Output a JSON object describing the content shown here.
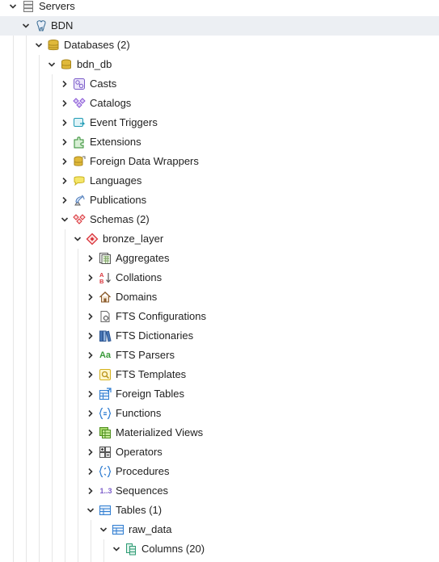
{
  "tree": {
    "servers": "Servers",
    "bdn": "BDN",
    "databases": "Databases (2)",
    "bdn_db": "bdn_db",
    "casts": "Casts",
    "catalogs": "Catalogs",
    "event_triggers": "Event Triggers",
    "extensions": "Extensions",
    "foreign_data_wrappers": "Foreign Data Wrappers",
    "languages": "Languages",
    "publications": "Publications",
    "schemas": "Schemas (2)",
    "bronze_layer": "bronze_layer",
    "aggregates": "Aggregates",
    "collations": "Collations",
    "domains": "Domains",
    "fts_configurations": "FTS Configurations",
    "fts_dictionaries": "FTS Dictionaries",
    "fts_parsers": "FTS Parsers",
    "fts_templates": "FTS Templates",
    "foreign_tables": "Foreign Tables",
    "functions": "Functions",
    "materialized_views": "Materialized Views",
    "operators": "Operators",
    "procedures": "Procedures",
    "sequences": "Sequences",
    "tables": "Tables (1)",
    "raw_data": "raw_data",
    "columns": "Columns (20)"
  },
  "icon_text": {
    "fts_parsers": "Aa",
    "sequences": "1..3",
    "collation_a": "A",
    "collation_b": "B"
  },
  "colors": {
    "selected_row": "#eceff3",
    "guide_line": "#e6e6e6",
    "db_gold": "#c9a227",
    "schema_red": "#d9343b",
    "casts_purple": "#7b5cc9",
    "table_blue": "#2f7dd1",
    "green": "#3a9a3a"
  }
}
